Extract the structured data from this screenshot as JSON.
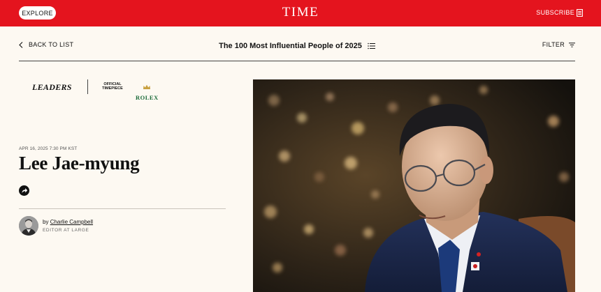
{
  "header": {
    "explore_label": "EXPLORE",
    "logo_text": "TIME",
    "subscribe_label": "SUBSCRIBE"
  },
  "subnav": {
    "back_label": "BACK TO LIST",
    "list_title": "The 100 Most Influential People of 2025",
    "filter_label": "FILTER"
  },
  "sponsor": {
    "category": "LEADERS",
    "official_line1": "OFFICIAL",
    "official_line2": "TIMEPIECE",
    "brand": "ROLEX"
  },
  "article": {
    "date": "APR 16, 2025 7:30 PM KST",
    "headline": "Lee Jae-myung",
    "byline_prefix": "by",
    "author_name": "Charlie Campbell",
    "author_role": "EDITOR AT LARGE"
  },
  "colors": {
    "brand_red": "#e4141e",
    "page_background": "#fdf9f2",
    "rolex_green": "#1b6b3a"
  },
  "icons": {
    "back": "chevron-left-icon",
    "list": "list-icon",
    "filter": "filter-icon",
    "subscribe": "subscribe-icon",
    "share": "share-arrow-icon",
    "crown": "crown-icon"
  }
}
